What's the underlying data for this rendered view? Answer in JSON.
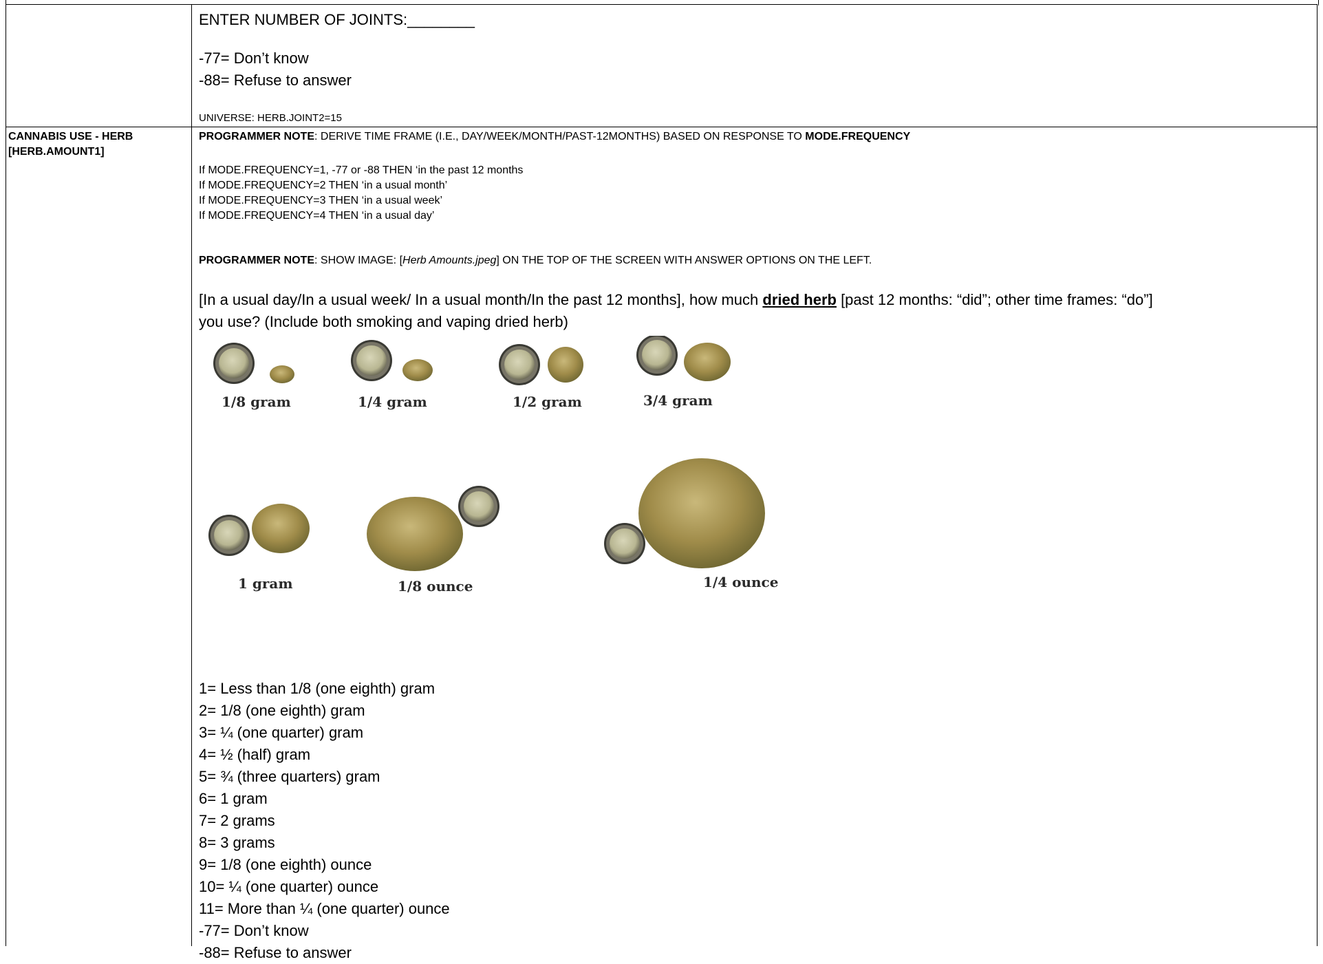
{
  "row_top": {
    "enter_prompt": "ENTER NUMBER OF JOINTS:________",
    "option_dont_know": "-77=  Don’t know",
    "option_refuse": "-88=  Refuse to answer",
    "universe": "UNIVERSE: HERB.JOINT2=15"
  },
  "row_main": {
    "topic_title": "CANNABIS USE - HERB",
    "variable_name": "[HERB.AMOUNT1]",
    "note1_label": "PROGRAMMER NOTE",
    "note1_text": ": DERIVE TIME FRAME (I.E., DAY/WEEK/MONTH/PAST-12MONTHS) BASED ON RESPONSE TO ",
    "note1_var": "MODE.FREQUENCY",
    "conditions": [
      "If MODE.FREQUENCY=1, -77 or -88  THEN ‘in the past 12 months",
      "If MODE.FREQUENCY=2 THEN ‘in a usual month’",
      "If MODE.FREQUENCY=3 THEN ‘in a usual week’",
      "If MODE.FREQUENCY=4 THEN ‘in a usual day’"
    ],
    "note2_label": "PROGRAMMER NOTE",
    "note2_pre": ":  SHOW IMAGE: [",
    "note2_file": "Herb Amounts.jpeg",
    "note2_post": "] ON THE TOP OF THE SCREEN WITH ANSWER OPTIONS ON THE LEFT.",
    "question_part1": " [In a usual day/In a usual week/ In a usual month/In the past 12 months], how much ",
    "question_emph": "dried herb",
    "question_part2": " [past 12 months: “did”; other time frames: “do”]",
    "question_line2": "you use? (Include both smoking and vaping dried herb)",
    "image_labels": [
      "1/8 gram",
      "1/4 gram",
      "1/2 gram",
      "3/4 gram",
      "1 gram",
      "1/8 ounce",
      "1/4 ounce"
    ],
    "answer_options": [
      "1= Less than 1/8 (one eighth) gram",
      "2= 1/8 (one eighth) gram",
      "3= ¼ (one quarter) gram",
      "4= ½ (half) gram",
      "5= ¾ (three quarters) gram",
      "6= 1 gram",
      "7= 2 grams",
      "8= 3 grams",
      "9= 1/8 (one eighth) ounce",
      "10= ¼ (one quarter) ounce",
      "11= More than ¼ (one quarter) ounce",
      "-77=  Don’t know",
      "-88=  Refuse to answer"
    ]
  }
}
